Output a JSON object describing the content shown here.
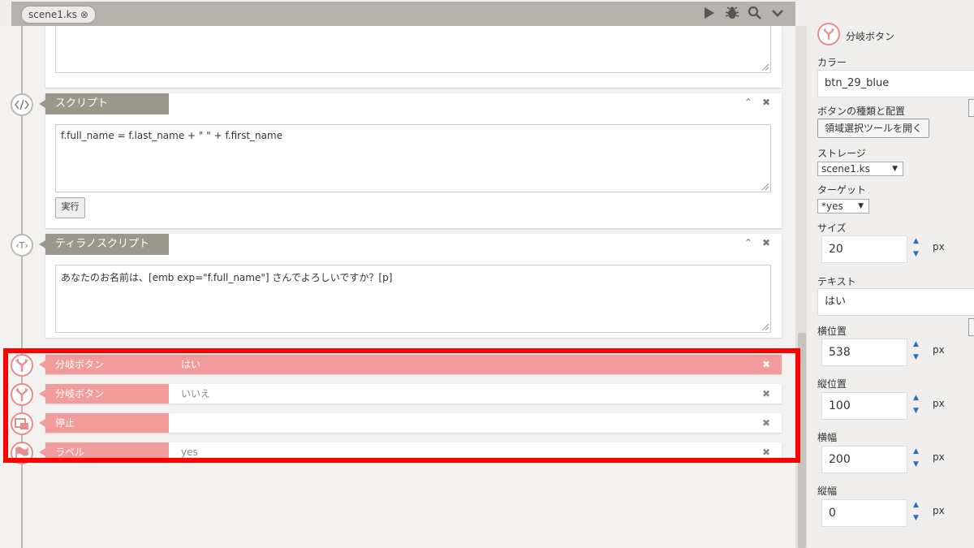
{
  "tabbar": {
    "tab_label": "scene1.ks"
  },
  "blocks": {
    "script": {
      "title": "スクリプト",
      "code": "f.full_name = f.last_name + \" \" +  f.first_name",
      "run_label": "実行"
    },
    "tyrano": {
      "title": "ティラノスクリプト",
      "code": "あなたのお名前は、[emb exp=\"f.full_name\"] さんでよろしいですか？[p]"
    }
  },
  "rows": [
    {
      "title": "分岐ボタン",
      "text": "はい"
    },
    {
      "title": "分岐ボタン",
      "text": "いいえ"
    },
    {
      "title": "停止",
      "text": ""
    },
    {
      "title": "ラベル",
      "text": "yes"
    }
  ],
  "panel": {
    "title": "分岐ボタン",
    "color_label": "カラー",
    "color_value": "btn_29_blue",
    "button_kind_label": "ボタンの種類と配置",
    "area_tool_button": "領域選択ツールを開く",
    "storage_label": "ストレージ",
    "storage_value": "scene1.ks",
    "target_label": "ターゲット",
    "target_value": "*yes",
    "size_label": "サイズ",
    "size_value": "20",
    "text_label": "テキスト",
    "text_value": "はい",
    "x_label": "横位置",
    "x_value": "538",
    "y_label": "縦位置",
    "y_value": "100",
    "width_label": "横幅",
    "width_value": "200",
    "height_label": "縦幅",
    "height_value": "0",
    "unit": "px"
  },
  "colors": {
    "highlight": "#ff0000",
    "row_accent": "#f29b9b",
    "block_title": "#9c968b"
  }
}
